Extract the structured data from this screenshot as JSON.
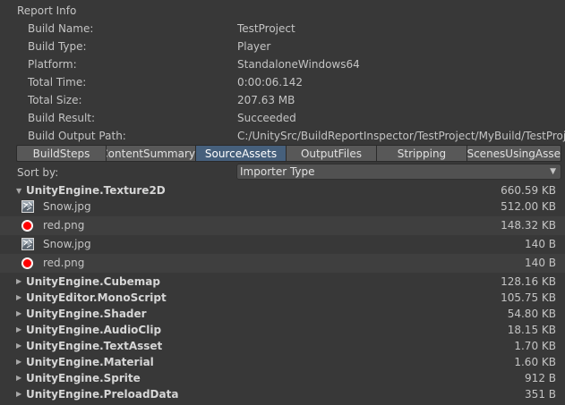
{
  "report": {
    "title": "Report Info",
    "rows": [
      {
        "label": "Build Name:",
        "value": "TestProject"
      },
      {
        "label": "Build Type:",
        "value": "Player"
      },
      {
        "label": "Platform:",
        "value": "StandaloneWindows64"
      },
      {
        "label": "Total Time:",
        "value": "0:00:06.142"
      },
      {
        "label": "Total Size:",
        "value": "207.63 MB"
      },
      {
        "label": "Build Result:",
        "value": "Succeeded"
      },
      {
        "label": "Build Output Path:",
        "value": "C:/UnitySrc/BuildReportInspector/TestProject/MyBuild/TestProje"
      }
    ]
  },
  "tabs": [
    {
      "label": "BuildSteps",
      "active": false
    },
    {
      "label": "ContentSummary",
      "active": false
    },
    {
      "label": "SourceAssets",
      "active": true
    },
    {
      "label": "OutputFiles",
      "active": false
    },
    {
      "label": "Stripping",
      "active": false
    },
    {
      "label": "ScenesUsingAsse",
      "active": false
    }
  ],
  "sort": {
    "label": "Sort by:",
    "selected": "Importer Type",
    "arrow_icon": "dropdown-triangle-icon"
  },
  "expanded_group": {
    "name": "UnityEngine.Texture2D",
    "size": "660.59 KB",
    "fold_glyph": "▼",
    "files": [
      {
        "name": "Snow.jpg",
        "size": "512.00 KB",
        "icon": "snow-texture-icon"
      },
      {
        "name": "red.png",
        "size": "148.32 KB",
        "icon": "red-texture-icon"
      },
      {
        "name": "Snow.jpg",
        "size": "140 B",
        "icon": "snow-texture-icon"
      },
      {
        "name": "red.png",
        "size": "140 B",
        "icon": "red-texture-icon"
      }
    ]
  },
  "collapsed_groups": [
    {
      "name": "UnityEngine.Cubemap",
      "size": "128.16 KB"
    },
    {
      "name": "UnityEditor.MonoScript",
      "size": "105.75 KB"
    },
    {
      "name": "UnityEngine.Shader",
      "size": "54.80 KB"
    },
    {
      "name": "UnityEngine.AudioClip",
      "size": "18.15 KB"
    },
    {
      "name": "UnityEngine.TextAsset",
      "size": "1.70 KB"
    },
    {
      "name": "UnityEngine.Material",
      "size": "1.60 KB"
    },
    {
      "name": "UnityEngine.Sprite",
      "size": "912 B"
    },
    {
      "name": "UnityEngine.PreloadData",
      "size": "351 B"
    }
  ],
  "collapsed_fold_glyph": "▶",
  "colors": {
    "background": "#383838",
    "active_tab": "#46607c",
    "tab": "#585858",
    "alt_row": "#3f3f3f",
    "red_icon": "#ff0000"
  }
}
